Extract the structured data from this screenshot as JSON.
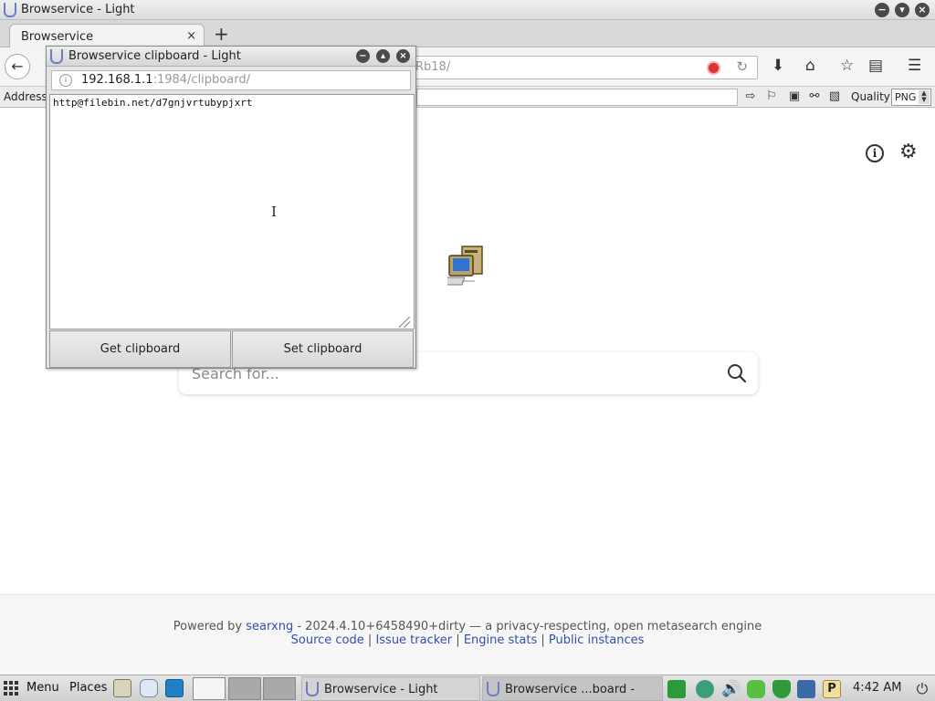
{
  "main_window": {
    "title": "Browservice - Light",
    "tab": {
      "label": "Browservice",
      "close_glyph": "×"
    },
    "newtab_glyph": "+",
    "url_path": "Rb18/",
    "address_label": "Address",
    "quality_label": "Quality",
    "format_value": "PNG"
  },
  "page": {
    "search_placeholder": "Search for...",
    "info_glyph": "i",
    "gear_glyph": "⚙",
    "footer": {
      "powered_prefix": "Powered by",
      "powered_link": "searxng",
      "powered_suffix": "- 2024.4.10+6458490+dirty — a privacy-respecting, open metasearch engine",
      "links": [
        "Source code",
        "Issue tracker",
        "Engine stats",
        "Public instances"
      ],
      "separator": "|"
    }
  },
  "popup": {
    "title": "Browservice clipboard - Light",
    "url_host": "192.168.1.1",
    "url_rest": ":1984/clipboard/",
    "clipboard_text": "http@filebin.net/d7gnjvrtubypjxrt",
    "get_button": "Get clipboard",
    "set_button": "Set clipboard",
    "cursor_glyph": "I"
  },
  "taskbar": {
    "menu_label": "Menu",
    "places_label": "Places",
    "tasks": [
      "Browservice - Light",
      "Browservice ...board - Light"
    ],
    "clock": "4:42 AM"
  },
  "colors": {
    "link": "#3050b0",
    "app_glyph": "#6b7cc8"
  }
}
